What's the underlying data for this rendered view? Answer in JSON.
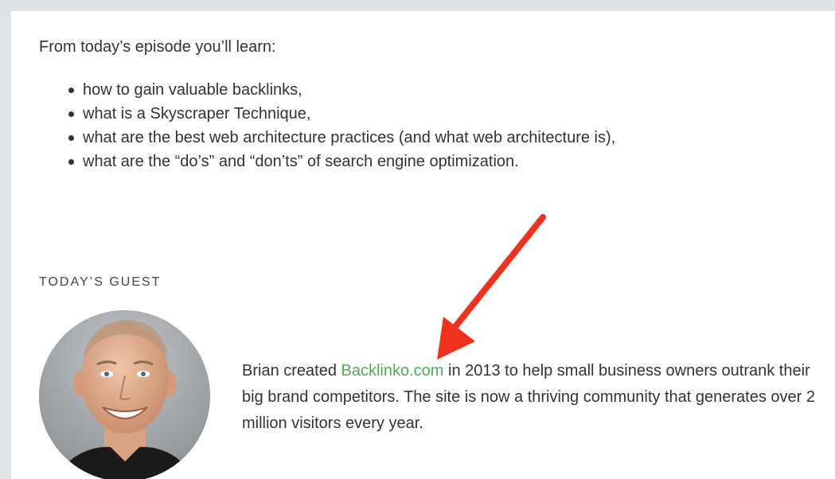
{
  "intro": "From today’s episode you’ll learn:",
  "lessons": [
    "how to gain valuable backlinks,",
    "what is a Skyscraper Technique,",
    "what are the best web architecture practices (and what web architecture is),",
    "what are the “do’s” and “don’ts” of search engine optimization."
  ],
  "guest": {
    "heading": "TODAY’S GUEST",
    "bio_before": "Brian created ",
    "bio_link": "Backlinko.com",
    "bio_after": " in 2013 to help small business owners outrank their big brand competitors. The site is now a thriving community that generates over 2 million visitors every year."
  },
  "colors": {
    "link": "#4caf50",
    "arrow": "#f0311c",
    "background": "#dfe3e8"
  },
  "icons": {
    "annotation": "red-arrow-icon",
    "list_marker": "bullet-icon"
  }
}
